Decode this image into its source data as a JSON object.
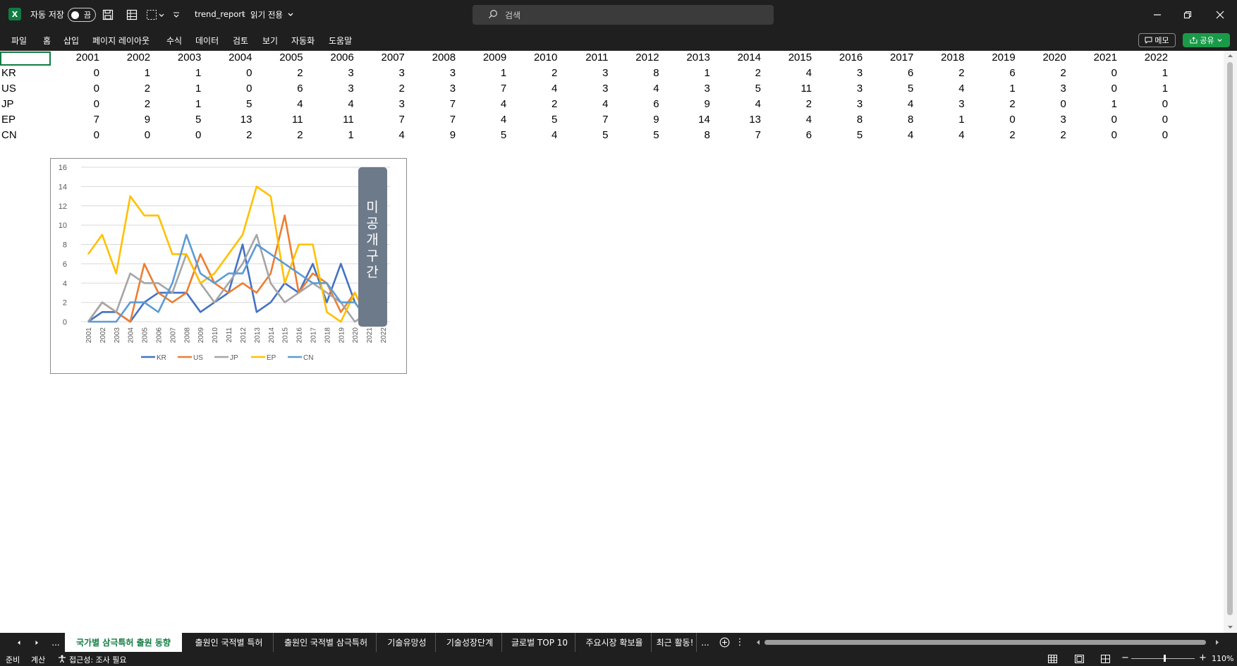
{
  "titlebar": {
    "autosave_label": "자동 저장",
    "autosave_state": "끔",
    "filename": "trend_report",
    "mode": "읽기 전용",
    "search_placeholder": "검색"
  },
  "menu": [
    "파일",
    "홈",
    "삽입",
    "페이지 레이아웃",
    "수식",
    "데이터",
    "검토",
    "보기",
    "자동화",
    "도움말"
  ],
  "actions": {
    "memo": "메모",
    "share": "공유"
  },
  "sheet": {
    "years": [
      "2001",
      "2002",
      "2003",
      "2004",
      "2005",
      "2006",
      "2007",
      "2008",
      "2009",
      "2010",
      "2011",
      "2012",
      "2013",
      "2014",
      "2015",
      "2016",
      "2017",
      "2018",
      "2019",
      "2020",
      "2021",
      "2022"
    ],
    "rows": [
      {
        "label": "KR",
        "values": [
          0,
          1,
          1,
          0,
          2,
          3,
          3,
          3,
          1,
          2,
          3,
          8,
          1,
          2,
          4,
          3,
          6,
          2,
          6,
          2,
          0,
          1
        ]
      },
      {
        "label": "US",
        "values": [
          0,
          2,
          1,
          0,
          6,
          3,
          2,
          3,
          7,
          4,
          3,
          4,
          3,
          5,
          11,
          3,
          5,
          4,
          1,
          3,
          0,
          1
        ]
      },
      {
        "label": "JP",
        "values": [
          0,
          2,
          1,
          5,
          4,
          4,
          3,
          7,
          4,
          2,
          4,
          6,
          9,
          4,
          2,
          3,
          4,
          3,
          2,
          0,
          1,
          0
        ]
      },
      {
        "label": "EP",
        "values": [
          7,
          9,
          5,
          13,
          11,
          11,
          7,
          7,
          4,
          5,
          7,
          9,
          14,
          13,
          4,
          8,
          8,
          1,
          0,
          3,
          0,
          0
        ]
      },
      {
        "label": "CN",
        "values": [
          0,
          0,
          0,
          2,
          2,
          1,
          4,
          9,
          5,
          4,
          5,
          5,
          8,
          7,
          6,
          5,
          4,
          4,
          2,
          2,
          0,
          0
        ]
      }
    ]
  },
  "chart_data": {
    "type": "line",
    "x": [
      "2001",
      "2002",
      "2003",
      "2004",
      "2005",
      "2006",
      "2007",
      "2008",
      "2009",
      "2010",
      "2011",
      "2012",
      "2013",
      "2014",
      "2015",
      "2016",
      "2017",
      "2018",
      "2019",
      "2020",
      "2021",
      "2022"
    ],
    "ylim": [
      0,
      16
    ],
    "yticks": [
      "0",
      "2",
      "4",
      "6",
      "8",
      "10",
      "12",
      "14",
      "16"
    ],
    "grid": true,
    "legend": "bottom",
    "series": [
      {
        "name": "KR",
        "color": "#4472c4",
        "values": [
          0,
          1,
          1,
          0,
          2,
          3,
          3,
          3,
          1,
          2,
          3,
          8,
          1,
          2,
          4,
          3,
          6,
          2,
          6,
          2,
          0,
          1
        ]
      },
      {
        "name": "US",
        "color": "#ed7d31",
        "values": [
          0,
          2,
          1,
          0,
          6,
          3,
          2,
          3,
          7,
          4,
          3,
          4,
          3,
          5,
          11,
          3,
          5,
          4,
          1,
          3,
          0,
          1
        ]
      },
      {
        "name": "JP",
        "color": "#a5a5a5",
        "values": [
          0,
          2,
          1,
          5,
          4,
          4,
          3,
          7,
          4,
          2,
          4,
          6,
          9,
          4,
          2,
          3,
          4,
          3,
          2,
          0,
          1,
          0
        ]
      },
      {
        "name": "EP",
        "color": "#ffc000",
        "values": [
          7,
          9,
          5,
          13,
          11,
          11,
          7,
          7,
          4,
          5,
          7,
          9,
          14,
          13,
          4,
          8,
          8,
          1,
          0,
          3,
          0,
          0
        ]
      },
      {
        "name": "CN",
        "color": "#5b9bd5",
        "values": [
          0,
          0,
          0,
          2,
          2,
          1,
          4,
          9,
          5,
          4,
          5,
          5,
          8,
          7,
          6,
          5,
          4,
          4,
          2,
          2,
          0,
          0
        ]
      }
    ],
    "annotation": "미공개구간"
  },
  "tabs": {
    "more": "...",
    "sheets": [
      {
        "label": "국가별 삼극특허 출원 동향",
        "active": true
      },
      {
        "label": "출원인 국적별 특허",
        "active": false
      },
      {
        "label": "출원인 국적별 삼극특허",
        "active": false
      },
      {
        "label": "기술유망성",
        "active": false
      },
      {
        "label": "기술성장단계",
        "active": false
      },
      {
        "label": "글로벌 TOP 10",
        "active": false
      },
      {
        "label": "주요시장 확보율",
        "active": false
      },
      {
        "label": "최근 활동!",
        "active": false
      }
    ],
    "overflow": "..."
  },
  "status": {
    "ready": "준비",
    "calc": "계산",
    "accessibility": "접근성: 조사 필요",
    "zoom": "110%"
  }
}
